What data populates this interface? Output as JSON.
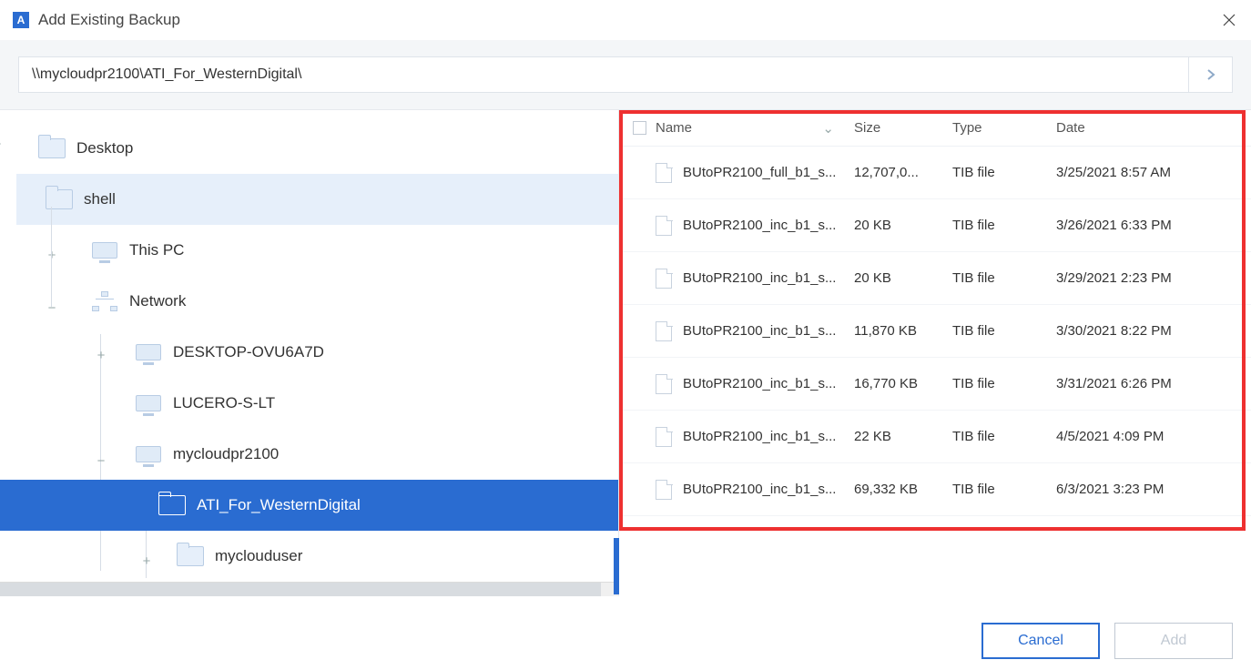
{
  "window": {
    "title": "Add Existing Backup",
    "app_letter": "A"
  },
  "path": {
    "value": "\\\\mycloudpr2100\\ATI_For_WesternDigital\\"
  },
  "tree": {
    "desktop": "Desktop",
    "shell": "shell",
    "thispc": "This PC",
    "network": "Network",
    "node1": "DESKTOP-OVU6A7D",
    "node2": "LUCERO-S-LT",
    "node3": "mycloudpr2100",
    "selected": "ATI_For_WesternDigital",
    "node4": "myclouduser"
  },
  "columns": {
    "name": "Name",
    "size": "Size",
    "type": "Type",
    "date": "Date"
  },
  "files": [
    {
      "name": "BUtoPR2100_full_b1_s...",
      "size": "12,707,0...",
      "type": "TIB file",
      "date": "3/25/2021 8:57 AM"
    },
    {
      "name": "BUtoPR2100_inc_b1_s...",
      "size": "20 KB",
      "type": "TIB file",
      "date": "3/26/2021 6:33 PM"
    },
    {
      "name": "BUtoPR2100_inc_b1_s...",
      "size": "20 KB",
      "type": "TIB file",
      "date": "3/29/2021 2:23 PM"
    },
    {
      "name": "BUtoPR2100_inc_b1_s...",
      "size": "11,870 KB",
      "type": "TIB file",
      "date": "3/30/2021 8:22 PM"
    },
    {
      "name": "BUtoPR2100_inc_b1_s...",
      "size": "16,770 KB",
      "type": "TIB file",
      "date": "3/31/2021 6:26 PM"
    },
    {
      "name": "BUtoPR2100_inc_b1_s...",
      "size": "22 KB",
      "type": "TIB file",
      "date": "4/5/2021 4:09 PM"
    },
    {
      "name": "BUtoPR2100_inc_b1_s...",
      "size": "69,332 KB",
      "type": "TIB file",
      "date": "6/3/2021 3:23 PM"
    }
  ],
  "buttons": {
    "cancel": "Cancel",
    "add": "Add"
  }
}
